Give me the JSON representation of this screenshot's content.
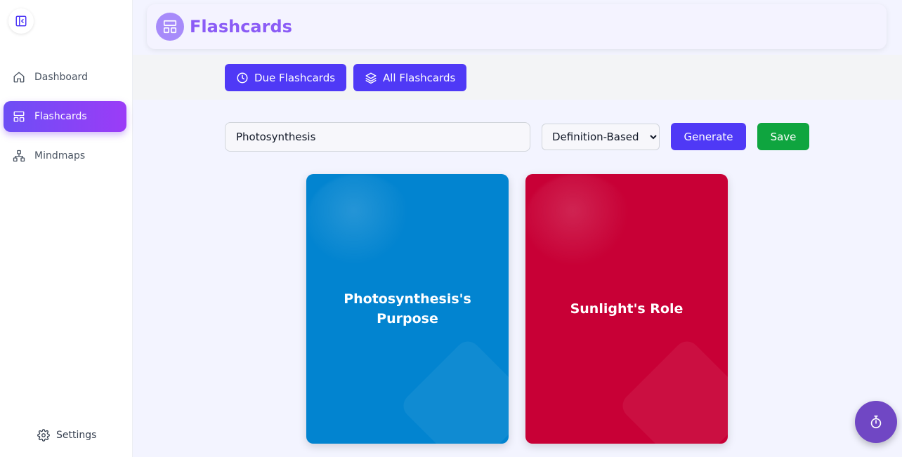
{
  "sidebar": {
    "items": [
      {
        "label": "Dashboard",
        "icon": "home-icon",
        "active": false
      },
      {
        "label": "Flashcards",
        "icon": "layout-icon",
        "active": true
      },
      {
        "label": "Mindmaps",
        "icon": "sitemap-icon",
        "active": false
      }
    ],
    "settings_label": "Settings",
    "settings_icon": "gear-icon",
    "collapse_icon": "sidebar-collapse-icon"
  },
  "header": {
    "title": "Flashcards",
    "logo_icon": "layout-icon"
  },
  "tabs": [
    {
      "label": "Due Flashcards",
      "icon": "clock-icon"
    },
    {
      "label": "All Flashcards",
      "icon": "layers-icon"
    }
  ],
  "controls": {
    "topic_value": "Photosynthesis",
    "type_selected": "Definition-Based",
    "generate_label": "Generate",
    "save_label": "Save"
  },
  "cards": [
    {
      "text": "Photosynthesis's Purpose",
      "color": "#0284d0"
    },
    {
      "text": "Sunlight's Role",
      "color": "#c80036"
    }
  ],
  "timer": {
    "icon": "stopwatch-icon"
  },
  "colors": {
    "accent": "#4f39f6",
    "brand_purple": "#8b5cf6",
    "save_green": "#0fa53f",
    "active_gradient_start": "#6d4ef5",
    "active_gradient_end": "#9b3cf7"
  }
}
